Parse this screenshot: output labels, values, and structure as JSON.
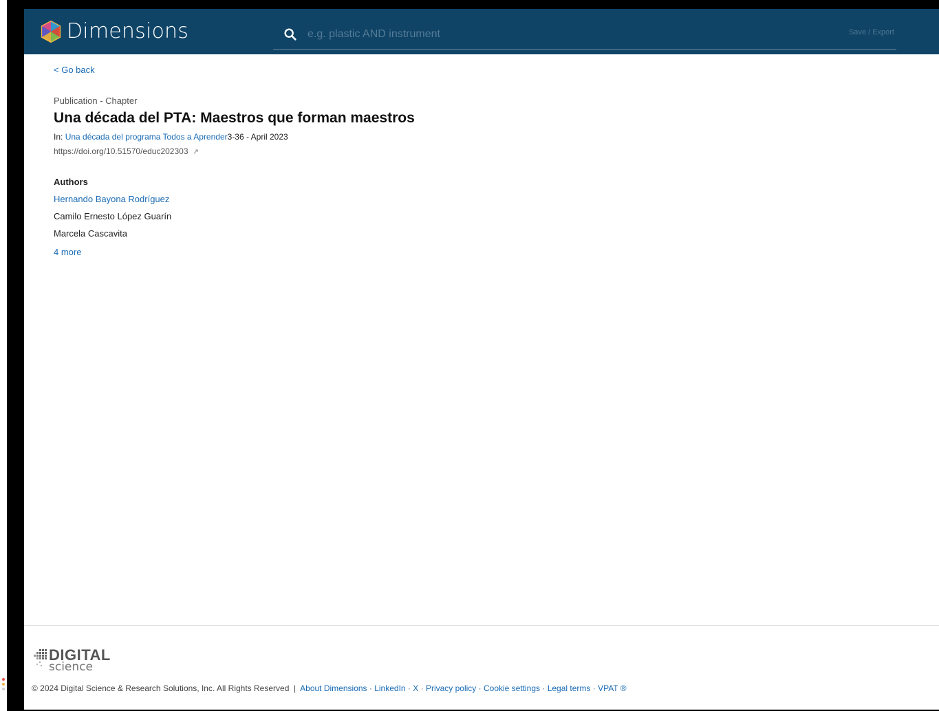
{
  "header": {
    "brand": "Dimensions",
    "search_placeholder": "e.g. plastic AND instrument",
    "save_export": "Save / Export",
    "bg_color": "#0f4467"
  },
  "nav": {
    "go_back": "< Go back"
  },
  "publication": {
    "type": "Publication - Chapter",
    "title": "Una década del PTA: Maestros que forman maestros",
    "in_prefix": "In: ",
    "book_title": "Una década del programa Todos a Aprender",
    "pages_date": "3-36 - April 2023",
    "doi": "https://doi.org/10.51570/educ202303",
    "doi_icon": "external-link-icon"
  },
  "authors": {
    "heading": "Authors",
    "list": [
      {
        "name": "Hernando Bayona Rodríguez",
        "linked": true
      },
      {
        "name": "Camilo Ernesto López Guarín",
        "linked": false
      },
      {
        "name": "Marcela Cascavita",
        "linked": false
      }
    ],
    "more": "4 more"
  },
  "footer": {
    "logo_top": "DIGITAL",
    "logo_bottom": "science",
    "copyright": "© 2024 Digital Science & Research Solutions, Inc. All Rights Reserved  | ",
    "links": [
      "About Dimensions",
      "LinkedIn",
      "X",
      "Privacy policy",
      "Cookie settings",
      "Legal terms",
      "VPAT ®"
    ],
    "separator": " · "
  }
}
